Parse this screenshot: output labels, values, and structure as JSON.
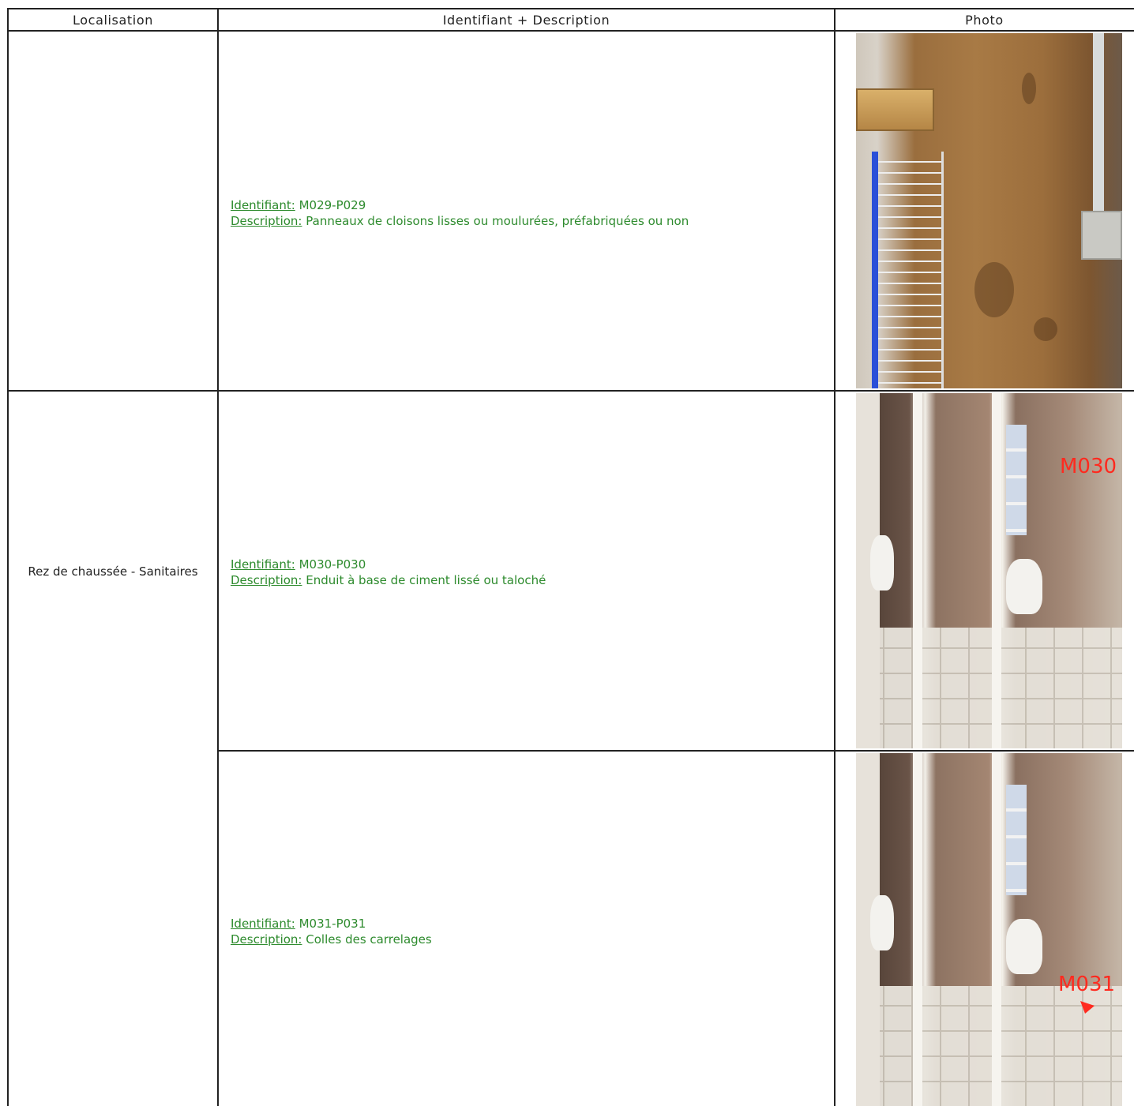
{
  "table": {
    "headers": {
      "location": "Localisation",
      "identifier": "Identifiant + Description",
      "photo": "Photo"
    },
    "rows": [
      {
        "identifier_label": "Identifiant:",
        "identifier": "M029-P029",
        "description_label": "Description:",
        "description": "Panneaux de cloisons lisses ou moulurées, préfabriquées ou non"
      },
      {
        "location": "Rez de chaussée - Sanitaires",
        "identifier_label": "Identifiant:",
        "identifier": "M030-P030",
        "description_label": "Description:",
        "description": "Enduit à base de ciment lissé ou taloché",
        "photo_mark": "M030"
      },
      {
        "identifier_label": "Identifiant:",
        "identifier": "M031-P031",
        "description_label": "Description:",
        "description": "Colles des carrelages",
        "photo_mark": "M031"
      }
    ]
  },
  "colors": {
    "text_green": "#2e8b2e",
    "marker_red": "#ff2a1f",
    "border": "#222222"
  }
}
